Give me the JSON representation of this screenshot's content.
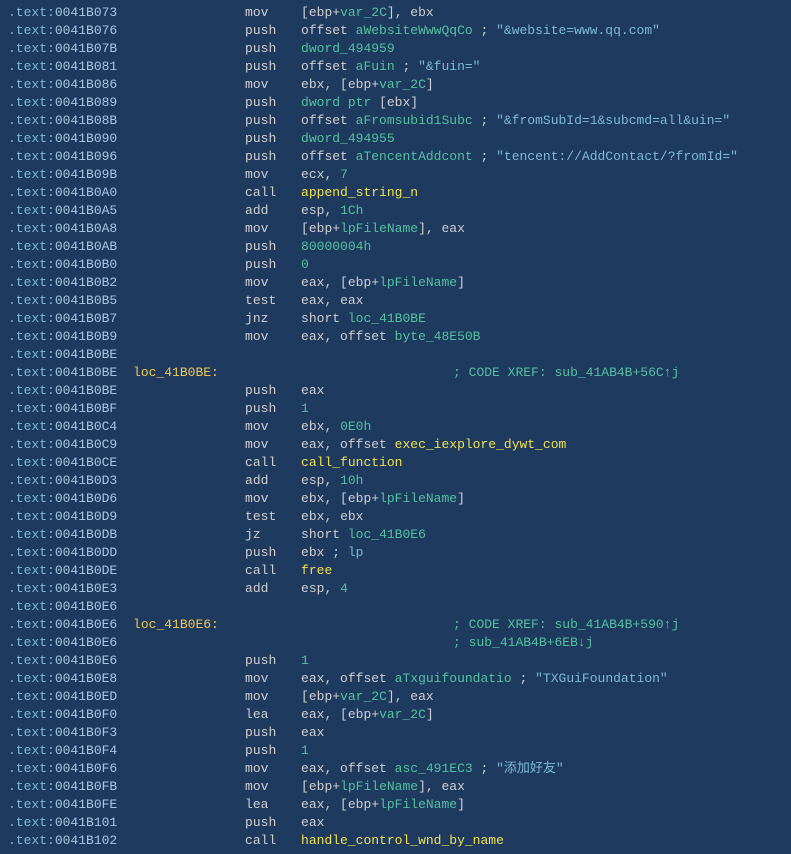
{
  "lines": [
    {
      "seg": ".text:",
      "addr": "0041B073",
      "mnem": "mov",
      "ops": [
        {
          "t": "[",
          "c": "d"
        },
        {
          "t": "ebp",
          "c": "d"
        },
        {
          "t": "+",
          "c": "d"
        },
        {
          "t": "var_2C",
          "c": "var"
        },
        {
          "t": "], ",
          "c": "d"
        },
        {
          "t": "ebx",
          "c": "d"
        }
      ]
    },
    {
      "seg": ".text:",
      "addr": "0041B076",
      "mnem": "push",
      "ops": [
        {
          "t": "offset ",
          "c": "d"
        },
        {
          "t": "aWebsiteWwwQqCo",
          "c": "ident"
        },
        {
          "t": " ; ",
          "c": "d"
        },
        {
          "t": "\"&website=www.qq.com\"",
          "c": "comment"
        }
      ]
    },
    {
      "seg": ".text:",
      "addr": "0041B07B",
      "mnem": "push",
      "ops": [
        {
          "t": "dword_494959",
          "c": "ident"
        }
      ]
    },
    {
      "seg": ".text:",
      "addr": "0041B081",
      "mnem": "push",
      "ops": [
        {
          "t": "offset ",
          "c": "d"
        },
        {
          "t": "aFuin",
          "c": "ident"
        },
        {
          "t": "    ; ",
          "c": "d"
        },
        {
          "t": "\"&fuin=\"",
          "c": "comment"
        }
      ]
    },
    {
      "seg": ".text:",
      "addr": "0041B086",
      "mnem": "mov",
      "ops": [
        {
          "t": "ebx",
          "c": "d"
        },
        {
          "t": ", [",
          "c": "d"
        },
        {
          "t": "ebp",
          "c": "d"
        },
        {
          "t": "+",
          "c": "d"
        },
        {
          "t": "var_2C",
          "c": "var"
        },
        {
          "t": "]",
          "c": "d"
        }
      ]
    },
    {
      "seg": ".text:",
      "addr": "0041B089",
      "mnem": "push",
      "ops": [
        {
          "t": "dword ptr ",
          "c": "num"
        },
        {
          "t": "[",
          "c": "d"
        },
        {
          "t": "ebx",
          "c": "d"
        },
        {
          "t": "]",
          "c": "d"
        }
      ]
    },
    {
      "seg": ".text:",
      "addr": "0041B08B",
      "mnem": "push",
      "ops": [
        {
          "t": "offset ",
          "c": "d"
        },
        {
          "t": "aFromsubid1Subc",
          "c": "ident"
        },
        {
          "t": " ; ",
          "c": "d"
        },
        {
          "t": "\"&fromSubId=1&subcmd=all&uin=\"",
          "c": "comment"
        }
      ]
    },
    {
      "seg": ".text:",
      "addr": "0041B090",
      "mnem": "push",
      "ops": [
        {
          "t": "dword_494955",
          "c": "ident"
        }
      ]
    },
    {
      "seg": ".text:",
      "addr": "0041B096",
      "mnem": "push",
      "ops": [
        {
          "t": "offset ",
          "c": "d"
        },
        {
          "t": "aTencentAddcont",
          "c": "ident"
        },
        {
          "t": " ; ",
          "c": "d"
        },
        {
          "t": "\"tencent://AddContact/?fromId=\"",
          "c": "comment"
        }
      ]
    },
    {
      "seg": ".text:",
      "addr": "0041B09B",
      "mnem": "mov",
      "ops": [
        {
          "t": "ecx",
          "c": "d"
        },
        {
          "t": ", ",
          "c": "d"
        },
        {
          "t": "7",
          "c": "num"
        }
      ]
    },
    {
      "seg": ".text:",
      "addr": "0041B0A0",
      "mnem": "call",
      "ops": [
        {
          "t": "append_string_n",
          "c": "func"
        }
      ]
    },
    {
      "seg": ".text:",
      "addr": "0041B0A5",
      "mnem": "add",
      "ops": [
        {
          "t": "esp",
          "c": "d"
        },
        {
          "t": ", ",
          "c": "d"
        },
        {
          "t": "1Ch",
          "c": "num"
        }
      ]
    },
    {
      "seg": ".text:",
      "addr": "0041B0A8",
      "mnem": "mov",
      "ops": [
        {
          "t": "[",
          "c": "d"
        },
        {
          "t": "ebp",
          "c": "d"
        },
        {
          "t": "+",
          "c": "d"
        },
        {
          "t": "lpFileName",
          "c": "var"
        },
        {
          "t": "], ",
          "c": "d"
        },
        {
          "t": "eax",
          "c": "d"
        }
      ]
    },
    {
      "seg": ".text:",
      "addr": "0041B0AB",
      "mnem": "push",
      "ops": [
        {
          "t": "80000004h",
          "c": "num"
        }
      ]
    },
    {
      "seg": ".text:",
      "addr": "0041B0B0",
      "mnem": "push",
      "ops": [
        {
          "t": "0",
          "c": "num"
        }
      ]
    },
    {
      "seg": ".text:",
      "addr": "0041B0B2",
      "mnem": "mov",
      "ops": [
        {
          "t": "eax",
          "c": "d"
        },
        {
          "t": ", [",
          "c": "d"
        },
        {
          "t": "ebp",
          "c": "d"
        },
        {
          "t": "+",
          "c": "d"
        },
        {
          "t": "lpFileName",
          "c": "var"
        },
        {
          "t": "]",
          "c": "d"
        }
      ]
    },
    {
      "seg": ".text:",
      "addr": "0041B0B5",
      "mnem": "test",
      "ops": [
        {
          "t": "eax",
          "c": "d"
        },
        {
          "t": ", ",
          "c": "d"
        },
        {
          "t": "eax",
          "c": "d"
        }
      ]
    },
    {
      "seg": ".text:",
      "addr": "0041B0B7",
      "mnem": "jnz",
      "ops": [
        {
          "t": "short ",
          "c": "d"
        },
        {
          "t": "loc_41B0BE",
          "c": "ident"
        }
      ]
    },
    {
      "seg": ".text:",
      "addr": "0041B0B9",
      "mnem": "mov",
      "ops": [
        {
          "t": "eax",
          "c": "d"
        },
        {
          "t": ", offset ",
          "c": "d"
        },
        {
          "t": "byte_48E50B",
          "c": "ident"
        }
      ]
    },
    {
      "seg": ".text:",
      "addr": "0041B0BE",
      "blank": true
    },
    {
      "seg": ".text:",
      "addr": "0041B0BE",
      "label": "loc_41B0BE:",
      "xref": "; CODE XREF: sub_41AB4B+56C↑j"
    },
    {
      "seg": ".text:",
      "addr": "0041B0BE",
      "mnem": "push",
      "ops": [
        {
          "t": "eax",
          "c": "d"
        }
      ]
    },
    {
      "seg": ".text:",
      "addr": "0041B0BF",
      "mnem": "push",
      "ops": [
        {
          "t": "1",
          "c": "num"
        }
      ]
    },
    {
      "seg": ".text:",
      "addr": "0041B0C4",
      "mnem": "mov",
      "ops": [
        {
          "t": "ebx",
          "c": "d"
        },
        {
          "t": ", ",
          "c": "d"
        },
        {
          "t": "0E0h",
          "c": "num"
        }
      ]
    },
    {
      "seg": ".text:",
      "addr": "0041B0C9",
      "mnem": "mov",
      "ops": [
        {
          "t": "eax",
          "c": "d"
        },
        {
          "t": ", offset ",
          "c": "d"
        },
        {
          "t": "exec_iexplore_dywt_com",
          "c": "func"
        }
      ]
    },
    {
      "seg": ".text:",
      "addr": "0041B0CE",
      "mnem": "call",
      "ops": [
        {
          "t": "call_function",
          "c": "func"
        }
      ]
    },
    {
      "seg": ".text:",
      "addr": "0041B0D3",
      "mnem": "add",
      "ops": [
        {
          "t": "esp",
          "c": "d"
        },
        {
          "t": ", ",
          "c": "d"
        },
        {
          "t": "10h",
          "c": "num"
        }
      ]
    },
    {
      "seg": ".text:",
      "addr": "0041B0D6",
      "mnem": "mov",
      "ops": [
        {
          "t": "ebx",
          "c": "d"
        },
        {
          "t": ", [",
          "c": "d"
        },
        {
          "t": "ebp",
          "c": "d"
        },
        {
          "t": "+",
          "c": "d"
        },
        {
          "t": "lpFileName",
          "c": "var"
        },
        {
          "t": "]",
          "c": "d"
        }
      ]
    },
    {
      "seg": ".text:",
      "addr": "0041B0D9",
      "mnem": "test",
      "ops": [
        {
          "t": "ebx",
          "c": "d"
        },
        {
          "t": ", ",
          "c": "d"
        },
        {
          "t": "ebx",
          "c": "d"
        }
      ]
    },
    {
      "seg": ".text:",
      "addr": "0041B0DB",
      "mnem": "jz",
      "ops": [
        {
          "t": "short ",
          "c": "d"
        },
        {
          "t": "loc_41B0E6",
          "c": "ident"
        }
      ]
    },
    {
      "seg": ".text:",
      "addr": "0041B0DD",
      "mnem": "push",
      "ops": [
        {
          "t": "ebx",
          "c": "d"
        },
        {
          "t": "             ; ",
          "c": "d"
        },
        {
          "t": "lp",
          "c": "comment"
        }
      ]
    },
    {
      "seg": ".text:",
      "addr": "0041B0DE",
      "mnem": "call",
      "ops": [
        {
          "t": "free",
          "c": "func"
        }
      ]
    },
    {
      "seg": ".text:",
      "addr": "0041B0E3",
      "mnem": "add",
      "ops": [
        {
          "t": "esp",
          "c": "d"
        },
        {
          "t": ", ",
          "c": "d"
        },
        {
          "t": "4",
          "c": "num"
        }
      ]
    },
    {
      "seg": ".text:",
      "addr": "0041B0E6",
      "blank": true
    },
    {
      "seg": ".text:",
      "addr": "0041B0E6",
      "label": "loc_41B0E6:",
      "xref": "; CODE XREF: sub_41AB4B+590↑j"
    },
    {
      "seg": ".text:",
      "addr": "0041B0E6",
      "xrefonly": true,
      "xref": "; sub_41AB4B+6EB↓j"
    },
    {
      "seg": ".text:",
      "addr": "0041B0E6",
      "mnem": "push",
      "ops": [
        {
          "t": "1",
          "c": "num"
        }
      ]
    },
    {
      "seg": ".text:",
      "addr": "0041B0E8",
      "mnem": "mov",
      "ops": [
        {
          "t": "eax",
          "c": "d"
        },
        {
          "t": ", offset ",
          "c": "d"
        },
        {
          "t": "aTxguifoundatio",
          "c": "ident"
        },
        {
          "t": " ; ",
          "c": "d"
        },
        {
          "t": "\"TXGuiFoundation\"",
          "c": "comment"
        }
      ]
    },
    {
      "seg": ".text:",
      "addr": "0041B0ED",
      "mnem": "mov",
      "ops": [
        {
          "t": "[",
          "c": "d"
        },
        {
          "t": "ebp",
          "c": "d"
        },
        {
          "t": "+",
          "c": "d"
        },
        {
          "t": "var_2C",
          "c": "var"
        },
        {
          "t": "], ",
          "c": "d"
        },
        {
          "t": "eax",
          "c": "d"
        }
      ]
    },
    {
      "seg": ".text:",
      "addr": "0041B0F0",
      "mnem": "lea",
      "ops": [
        {
          "t": "eax",
          "c": "d"
        },
        {
          "t": ", [",
          "c": "d"
        },
        {
          "t": "ebp",
          "c": "d"
        },
        {
          "t": "+",
          "c": "d"
        },
        {
          "t": "var_2C",
          "c": "var"
        },
        {
          "t": "]",
          "c": "d"
        }
      ]
    },
    {
      "seg": ".text:",
      "addr": "0041B0F3",
      "mnem": "push",
      "ops": [
        {
          "t": "eax",
          "c": "d"
        }
      ]
    },
    {
      "seg": ".text:",
      "addr": "0041B0F4",
      "mnem": "push",
      "ops": [
        {
          "t": "1",
          "c": "num"
        }
      ]
    },
    {
      "seg": ".text:",
      "addr": "0041B0F6",
      "mnem": "mov",
      "ops": [
        {
          "t": "eax",
          "c": "d"
        },
        {
          "t": ", offset ",
          "c": "d"
        },
        {
          "t": "asc_491EC3",
          "c": "ident"
        },
        {
          "t": " ; ",
          "c": "d"
        },
        {
          "t": "\"添加好友\"",
          "c": "comment"
        }
      ]
    },
    {
      "seg": ".text:",
      "addr": "0041B0FB",
      "mnem": "mov",
      "ops": [
        {
          "t": "[",
          "c": "d"
        },
        {
          "t": "ebp",
          "c": "d"
        },
        {
          "t": "+",
          "c": "d"
        },
        {
          "t": "lpFileName",
          "c": "var"
        },
        {
          "t": "], ",
          "c": "d"
        },
        {
          "t": "eax",
          "c": "d"
        }
      ]
    },
    {
      "seg": ".text:",
      "addr": "0041B0FE",
      "mnem": "lea",
      "ops": [
        {
          "t": "eax",
          "c": "d"
        },
        {
          "t": ", [",
          "c": "d"
        },
        {
          "t": "ebp",
          "c": "d"
        },
        {
          "t": "+",
          "c": "d"
        },
        {
          "t": "lpFileName",
          "c": "var"
        },
        {
          "t": "]",
          "c": "d"
        }
      ]
    },
    {
      "seg": ".text:",
      "addr": "0041B101",
      "mnem": "push",
      "ops": [
        {
          "t": "eax",
          "c": "d"
        }
      ]
    },
    {
      "seg": ".text:",
      "addr": "0041B102",
      "mnem": "call",
      "ops": [
        {
          "t": "handle_control_wnd_by_name",
          "c": "func"
        }
      ]
    }
  ]
}
